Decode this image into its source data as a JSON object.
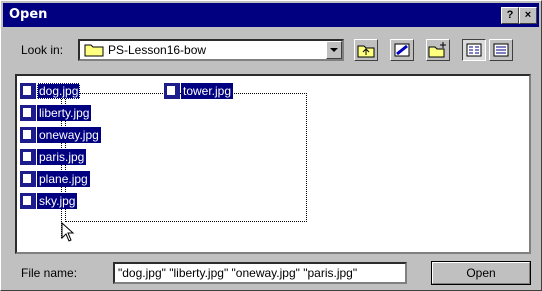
{
  "window": {
    "title": "Open",
    "help_btn": "?",
    "close_btn": "×"
  },
  "lookin": {
    "label": "Look in:",
    "value": "PS-Lesson16-bow"
  },
  "files": [
    {
      "name": "dog.jpg"
    },
    {
      "name": "liberty.jpg"
    },
    {
      "name": "oneway.jpg"
    },
    {
      "name": "paris.jpg"
    },
    {
      "name": "plane.jpg"
    },
    {
      "name": "sky.jpg"
    },
    {
      "name": "tower.jpg"
    }
  ],
  "filename": {
    "label": "File name:",
    "value": "\"dog.jpg\" \"liberty.jpg\" \"oneway.jpg\" \"paris.jpg\""
  },
  "buttons": {
    "open": "Open"
  },
  "icons": [
    "folder-icon",
    "chevron-down-icon",
    "up-folder-icon",
    "desktop-icon",
    "new-folder-icon",
    "list-view-icon",
    "details-view-icon",
    "image-file-icon",
    "arrow-cursor-icon"
  ]
}
